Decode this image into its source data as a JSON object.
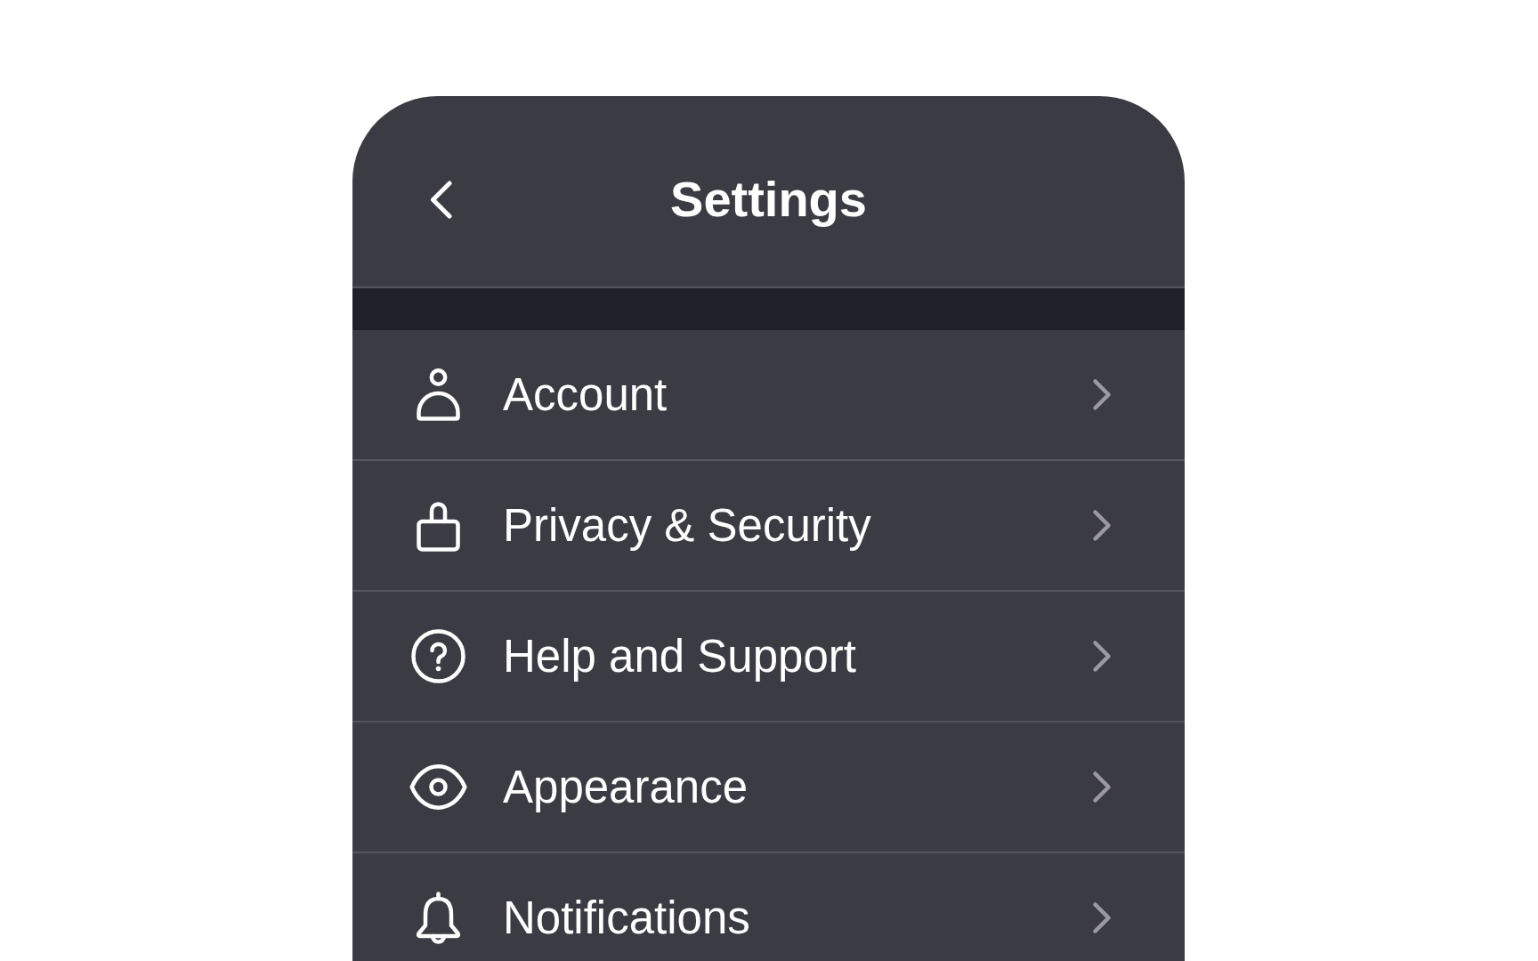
{
  "header": {
    "title": "Settings"
  },
  "items": [
    {
      "label": "Account"
    },
    {
      "label": "Privacy & Security"
    },
    {
      "label": "Help and Support"
    },
    {
      "label": "Appearance"
    },
    {
      "label": "Notifications"
    }
  ]
}
